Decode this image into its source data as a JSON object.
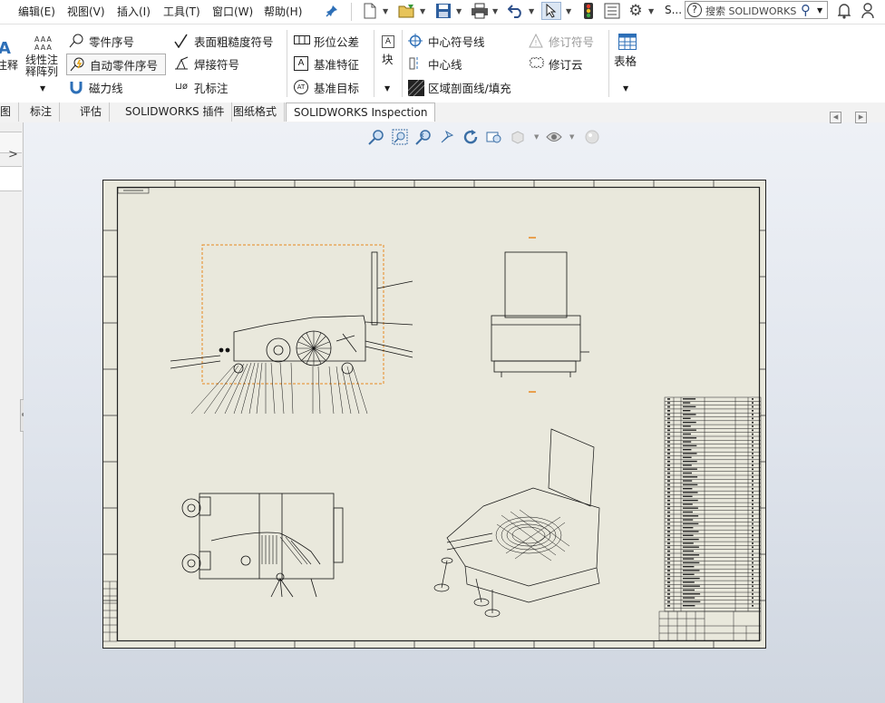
{
  "menubar": {
    "items": [
      "编辑(E)",
      "视图(V)",
      "插入(I)",
      "工具(T)",
      "窗口(W)",
      "帮助(H)"
    ],
    "s_label": "S...",
    "search_placeholder": "搜索 SOLIDWORKS"
  },
  "ribbon": {
    "annotation_partial": "注释",
    "linear_note_line1": "线性注",
    "linear_note_line2": "释阵列",
    "balloon": "零件序号",
    "auto_balloon": "自动零件序号",
    "magnetic_line": "磁力线",
    "surface_finish": "表面粗糙度符号",
    "weld_symbol": "焊接符号",
    "hole_callout": "孔标注",
    "hole_callout_icon_text": "⊔ø",
    "geometric_tolerance": "形位公差",
    "datum_feature": "基准特征",
    "datum_target": "基准目标",
    "datum_feature_icon_text": "A",
    "datum_target_icon_text": "AT",
    "block": "块",
    "center_mark": "中心符号线",
    "centerline": "中心线",
    "area_hatch": "区域剖面线/填充",
    "revision_symbol": "修订符号",
    "revision_cloud": "修订云",
    "table": "表格"
  },
  "tabs": [
    "图",
    "标注",
    "评估",
    "SOLIDWORKS 插件",
    "图纸格式",
    "SOLIDWORKS Inspection"
  ],
  "active_tab": "图纸格式",
  "colors": {
    "sheet_bg": "#e9e8dc",
    "selection_orange": "#e8871e",
    "view_icon_blue": "#3a6ea5"
  }
}
